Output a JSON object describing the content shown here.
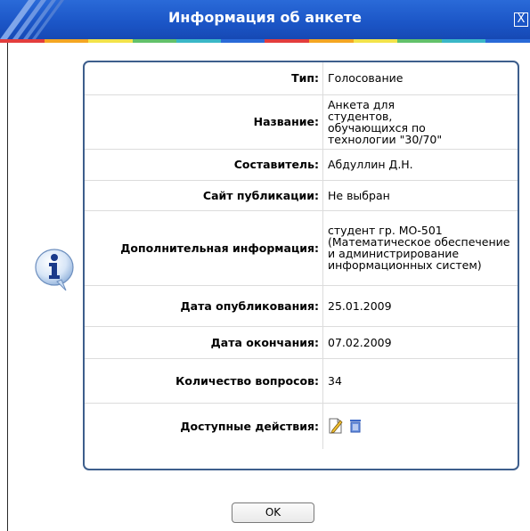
{
  "dialog": {
    "title": "Информация об анкете",
    "close_label": "X",
    "ok_label": "OK"
  },
  "info_rows": [
    {
      "label": "Тип:",
      "value": "Голосование"
    },
    {
      "label": "Название:",
      "value": "Анкета для студентов, обучающихся по технологии \"30/70\""
    },
    {
      "label": "Составитель:",
      "value": "Абдуллин Д.Н."
    },
    {
      "label": "Сайт публикации:",
      "value": "Не выбран"
    },
    {
      "label": "Дополнительная информация:",
      "value": "студент гр. МО-501 (Математическое обеспечение и администрирование информационных систем)"
    },
    {
      "label": "Дата опубликования:",
      "value": "25.01.2009"
    },
    {
      "label": "Дата окончания:",
      "value": "07.02.2009"
    },
    {
      "label": "Количество вопросов:",
      "value": "34"
    },
    {
      "label": "Доступные действия:"
    }
  ],
  "actions": {
    "edit_icon": "edit-icon",
    "delete_icon": "trash-icon"
  },
  "colors": {
    "titlebar": "#1b55c6",
    "panel_border": "#3d5e8c",
    "stripe": [
      "#e33d3d",
      "#f4a623",
      "#f2e34a",
      "#62c16b",
      "#3ab7c7",
      "#2a6ad8"
    ]
  }
}
